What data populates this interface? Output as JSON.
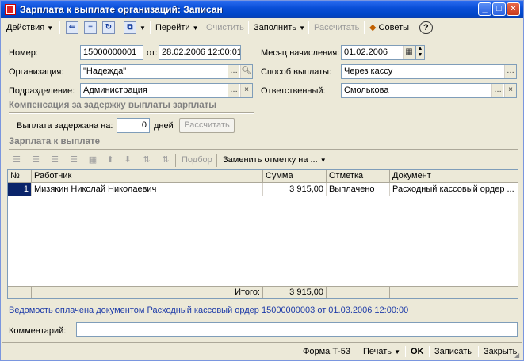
{
  "window": {
    "title": "Зарплата к выплате организаций: Записан"
  },
  "toolbar": {
    "actions_label": "Действия",
    "goto_label": "Перейти",
    "clear_label": "Очистить",
    "fill_label": "Заполнить",
    "calculate_label": "Рассчитать",
    "tips_label": "Советы",
    "help_label": "?"
  },
  "form": {
    "number_label": "Номер:",
    "number_value": "15000000001",
    "from_label": "от:",
    "date_value": "28.02.2006 12:00:01",
    "month_label": "Месяц начисления:",
    "month_value": "01.02.2006",
    "org_label": "Организация:",
    "org_value": "\"Надежда\"",
    "payment_method_label": "Способ выплаты:",
    "payment_method_value": "Через кассу",
    "department_label": "Подразделение:",
    "department_value": "Администрация",
    "responsible_label": "Ответственный:",
    "responsible_value": "Смолькова"
  },
  "compensation": {
    "section_title": "Компенсация за задержку выплаты зарплаты",
    "delay_label": "Выплата задержана на:",
    "delay_value": "0",
    "days_label": "дней",
    "calculate_label": "Рассчитать"
  },
  "payout": {
    "section_title": "Зарплата к выплате",
    "pick_label": "Подбор",
    "replace_mark_label": "Заменить отметку на ..."
  },
  "table": {
    "columns": [
      "№",
      "Работник",
      "Сумма",
      "Отметка",
      "Документ"
    ],
    "rows": [
      {
        "n": "1",
        "employee": "Мизякин Николай Николаевич",
        "amount": "3 915,00",
        "mark": "Выплачено",
        "document": "Расходный кассовый ордер ..."
      }
    ],
    "total_label": "Итого:",
    "total_value": "3 915,00"
  },
  "info": {
    "paid_link": "Ведомость оплачена документом Расходный кассовый ордер 15000000003 от 01.03.2006 12:00:00"
  },
  "comment": {
    "label": "Комментарий:",
    "value": ""
  },
  "statusbar": {
    "form_label": "Форма Т-53",
    "print_label": "Печать",
    "ok_label": "OK",
    "save_label": "Записать",
    "close_label": "Закрыть"
  }
}
